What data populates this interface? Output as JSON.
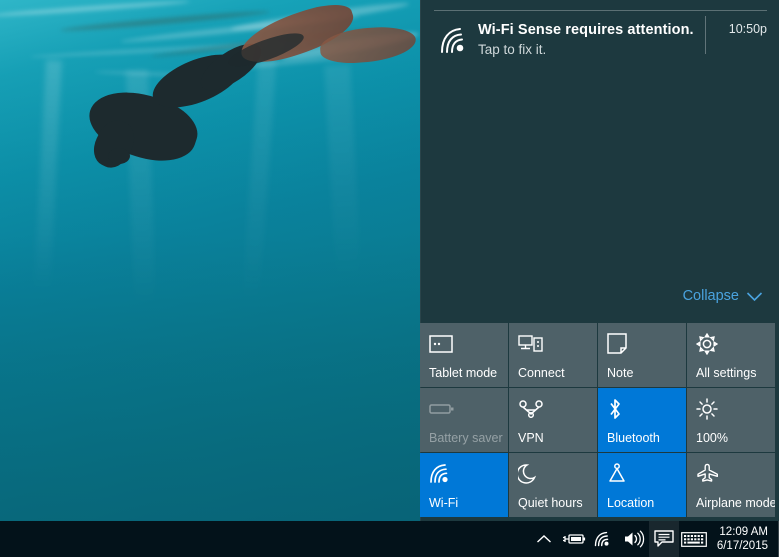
{
  "colors": {
    "panel_bg": "#1F3D44",
    "tile_inactive": "#4E6168",
    "tile_active": "#0078D7",
    "accent_link": "#4AA3DF",
    "taskbar": "#03121A",
    "water": "#0A85A0"
  },
  "wallpaper": {
    "name": "underwater-freediver-wallpaper",
    "description": "Underwater turquoise ocean scene with a freediver wearing monofin near the surface"
  },
  "action_center": {
    "notification": {
      "icon": "wifi-sense-icon",
      "title": "Wi-Fi Sense requires attention.",
      "subtitle": "Tap to fix it.",
      "time": "10:50p"
    },
    "collapse": {
      "label": "Collapse",
      "icon": "chevron-down-icon"
    },
    "quick_actions": [
      {
        "label": "Tablet mode",
        "icon": "tablet-mode-icon",
        "state": "off"
      },
      {
        "label": "Connect",
        "icon": "connect-icon",
        "state": "off"
      },
      {
        "label": "Note",
        "icon": "note-icon",
        "state": "off"
      },
      {
        "label": "All settings",
        "icon": "gear-icon",
        "state": "off"
      },
      {
        "label": "Battery saver",
        "icon": "battery-icon",
        "state": "disabled"
      },
      {
        "label": "VPN",
        "icon": "vpn-icon",
        "state": "off"
      },
      {
        "label": "Bluetooth",
        "icon": "bluetooth-icon",
        "state": "on"
      },
      {
        "label": "100%",
        "icon": "brightness-icon",
        "state": "off"
      },
      {
        "label": "Wi-Fi",
        "icon": "wifi-icon",
        "state": "on"
      },
      {
        "label": "Quiet hours",
        "icon": "moon-icon",
        "state": "off"
      },
      {
        "label": "Location",
        "icon": "location-icon",
        "state": "on"
      },
      {
        "label": "Airplane mode",
        "icon": "airplane-icon",
        "state": "off"
      }
    ]
  },
  "taskbar": {
    "tray_icons": [
      {
        "name": "show-hidden-icons-chevron-icon"
      },
      {
        "name": "battery-charging-icon"
      },
      {
        "name": "network-wifi-icon"
      },
      {
        "name": "volume-speaker-icon"
      },
      {
        "name": "action-center-icon"
      },
      {
        "name": "touch-keyboard-icon"
      }
    ],
    "clock": {
      "time": "12:09 AM",
      "date": "6/17/2015"
    }
  }
}
